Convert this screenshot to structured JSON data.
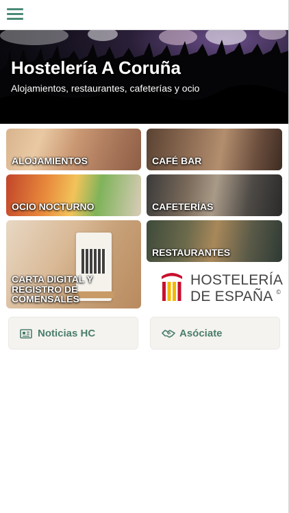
{
  "header": {
    "menu_icon": "hamburger-menu-icon",
    "accent": "#4a8a78"
  },
  "hero": {
    "title": "Hostelería A Coruña",
    "subtitle": "Alojamientos, restaurantes, cafeterías y ocio"
  },
  "tiles": {
    "alojamientos": "ALOJAMIENTOS",
    "cafe_bar": "CAFÉ BAR",
    "ocio_nocturno": "OCIO NOCTURNO",
    "cafeterias": "CAFETERÍAS",
    "carta": "CARTA DIGITAL Y REGISTRO DE COMENSALES",
    "restaurantes": "RESTAURANTES"
  },
  "logo": {
    "line1": "HOSTELERÍA",
    "line2": "DE ESPAÑA",
    "reg": "©"
  },
  "buttons": {
    "noticias": {
      "label": "Noticias HC",
      "icon": "newspaper-icon"
    },
    "asociate": {
      "label": "Asóciate",
      "icon": "handshake-icon"
    }
  },
  "colors": {
    "button_text": "#4a7d6c",
    "button_bg": "#f4f3ef",
    "logo_red": "#c8102e",
    "logo_yellow": "#f5b800"
  }
}
